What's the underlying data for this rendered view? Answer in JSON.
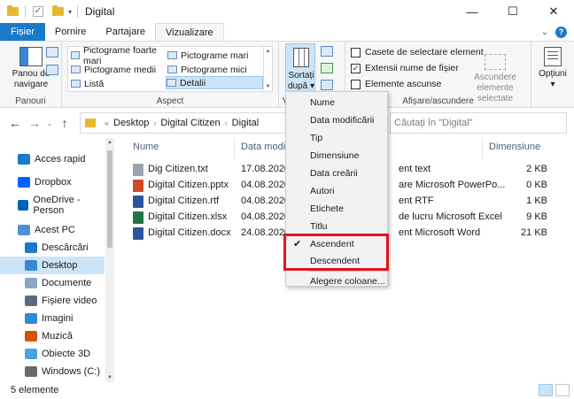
{
  "window": {
    "title": "Digital",
    "controls": {
      "minimize": "—",
      "maximize": "☐",
      "close": "✕"
    }
  },
  "ribbon_tabs": {
    "items": [
      "Fișier",
      "Pornire",
      "Partajare",
      "Vizualizare"
    ],
    "collapse_icon": "chevron-down-icon",
    "help_icon": "?"
  },
  "ribbon": {
    "panes_group": {
      "button_label": "Panou de navigare",
      "group_label": "Panouri"
    },
    "layout_group": {
      "items": [
        "Pictograme foarte mari",
        "Pictograme mari",
        "Pictograme medii",
        "Pictograme mici",
        "Listă",
        "Detalii"
      ],
      "selected": "Detalii",
      "group_label": "Aspect"
    },
    "current_view_group": {
      "sort_label": "Sortați după",
      "group_label": "V"
    },
    "show_hide_group": {
      "checkboxes": [
        {
          "label": "Casete de selectare element",
          "checked": false
        },
        {
          "label": "Extensii nume de fișier",
          "checked": true
        },
        {
          "label": "Elemente ascunse",
          "checked": false
        }
      ],
      "hide_selected_label": "Ascundere elemente selectate",
      "group_label": "Afișare/ascundere"
    },
    "options_label": "Opțiuni"
  },
  "navigation": {
    "breadcrumb": [
      "Desktop",
      "Digital Citizen",
      "Digital"
    ],
    "search_placeholder": "Căutați în \"Digital\""
  },
  "sidebar": {
    "items": [
      {
        "label": "Acces rapid",
        "icon": "star-icon",
        "color": "#1979ca"
      },
      {
        "label": "Dropbox",
        "icon": "dropbox-icon",
        "color": "#0061fe"
      },
      {
        "label": "OneDrive - Person",
        "icon": "cloud-icon",
        "color": "#0364b8"
      },
      {
        "label": "Acest PC",
        "icon": "computer-icon",
        "color": "#4f8fd6"
      },
      {
        "label": "Descărcări",
        "icon": "download-icon",
        "color": "#1979ca"
      },
      {
        "label": "Desktop",
        "icon": "desktop-icon",
        "color": "#3a87d6",
        "selected": true
      },
      {
        "label": "Documente",
        "icon": "documents-icon",
        "color": "#8aa7c4"
      },
      {
        "label": "Fișiere video",
        "icon": "video-icon",
        "color": "#5a6b7c"
      },
      {
        "label": "Imagini",
        "icon": "pictures-icon",
        "color": "#2f8bd6"
      },
      {
        "label": "Muzică",
        "icon": "music-icon",
        "color": "#d35400"
      },
      {
        "label": "Obiecte 3D",
        "icon": "3d-objects-icon",
        "color": "#4aa3df"
      },
      {
        "label": "Windows (C:)",
        "icon": "drive-icon",
        "color": "#6b6b6b"
      }
    ]
  },
  "file_list": {
    "columns": {
      "name": "Nume",
      "date": "Data modif",
      "size": "Dimensiune"
    },
    "rows": [
      {
        "name": "Dig Citizen.txt",
        "date": "17.08.2020",
        "type": "ent text",
        "size": "2 KB",
        "icon": "text-file-icon",
        "color": "#9aa5b1"
      },
      {
        "name": "Digital Citizen.pptx",
        "date": "04.08.2020",
        "type": "are Microsoft PowerPo...",
        "size": "0 KB",
        "icon": "powerpoint-icon",
        "color": "#d24726"
      },
      {
        "name": "Digital Citizen.rtf",
        "date": "04.08.2020",
        "type": "ent RTF",
        "size": "1 KB",
        "icon": "rtf-file-icon",
        "color": "#2b579a"
      },
      {
        "name": "Digital Citizen.xlsx",
        "date": "04.08.2020",
        "type": "de lucru Microsoft Excel",
        "size": "9 KB",
        "icon": "excel-icon",
        "color": "#217346"
      },
      {
        "name": "Digital Citizen.docx",
        "date": "24.08.2020",
        "type": "ent Microsoft Word",
        "size": "21 KB",
        "icon": "word-icon",
        "color": "#2b579a"
      }
    ]
  },
  "sort_menu": {
    "items": [
      "Nume",
      "Data modificării",
      "Tip",
      "Dimensiune",
      "Data creării",
      "Autori",
      "Etichete",
      "Titlu"
    ],
    "order_items": [
      {
        "label": "Ascendent",
        "checked": true
      },
      {
        "label": "Descendent",
        "checked": false
      }
    ],
    "choose_columns": "Alegere coloane..."
  },
  "status": {
    "count": "5 elemente"
  },
  "colors": {
    "accent": "#1979ca",
    "selection": "#cce4f7",
    "highlight_border": "#e1141e"
  }
}
